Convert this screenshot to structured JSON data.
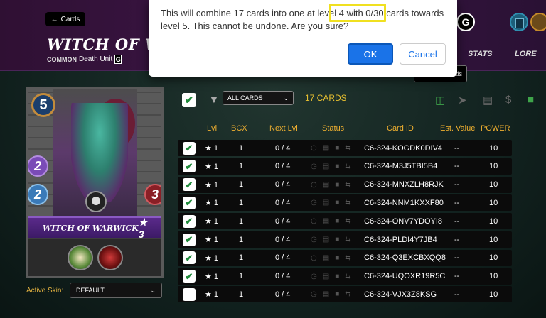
{
  "header": {
    "back_label": "Cards",
    "card_title": "WITCH OF WARW",
    "rarity": "COMMON",
    "subtitle": "Death Unit",
    "edition_logo": "G",
    "tabs": [
      "STATS",
      "LORE"
    ],
    "tooltip_stub": "ds",
    "icons": [
      "gladius-logo-icon",
      "cards-icon",
      "chest-icon"
    ]
  },
  "card": {
    "mana": "5",
    "magic": "2",
    "speed": "2",
    "health": "3",
    "name": "WITCH OF WARWICK",
    "level": "★ 3",
    "abilities": [
      "affliction-icon",
      "life-leech-icon"
    ]
  },
  "skin": {
    "label": "Active Skin:",
    "value": "DEFAULT"
  },
  "toolbar": {
    "filter_value": "ALL CARDS",
    "count": "17 CARDS",
    "icons": [
      "combine-icon",
      "send-icon",
      "market-icon",
      "sell-icon",
      "lock-icon"
    ]
  },
  "table": {
    "columns": [
      "Lvl",
      "BCX",
      "Next Lvl",
      "Status",
      "Card ID",
      "Est. Value",
      "POWER"
    ],
    "rows": [
      {
        "checked": true,
        "lvl": "★ 1",
        "bcx": "1",
        "next": "0 / 4",
        "id": "C6-324-KOGDK0DIV4",
        "est": "--",
        "power": "10"
      },
      {
        "checked": true,
        "lvl": "★ 1",
        "bcx": "1",
        "next": "0 / 4",
        "id": "C6-324-M3J5TBI5B4",
        "est": "--",
        "power": "10"
      },
      {
        "checked": true,
        "lvl": "★ 1",
        "bcx": "1",
        "next": "0 / 4",
        "id": "C6-324-MNXZLH8RJK",
        "est": "--",
        "power": "10"
      },
      {
        "checked": true,
        "lvl": "★ 1",
        "bcx": "1",
        "next": "0 / 4",
        "id": "C6-324-NNM1KXXF80",
        "est": "--",
        "power": "10"
      },
      {
        "checked": true,
        "lvl": "★ 1",
        "bcx": "1",
        "next": "0 / 4",
        "id": "C6-324-ONV7YDOYI8",
        "est": "--",
        "power": "10"
      },
      {
        "checked": true,
        "lvl": "★ 1",
        "bcx": "1",
        "next": "0 / 4",
        "id": "C6-324-PLDI4Y7JB4",
        "est": "--",
        "power": "10"
      },
      {
        "checked": true,
        "lvl": "★ 1",
        "bcx": "1",
        "next": "0 / 4",
        "id": "C6-324-Q3EXCBXQQ8",
        "est": "--",
        "power": "10"
      },
      {
        "checked": true,
        "lvl": "★ 1",
        "bcx": "1",
        "next": "0 / 4",
        "id": "C6-324-UQOXR19R5C",
        "est": "--",
        "power": "10"
      },
      {
        "checked": false,
        "lvl": "★ 1",
        "bcx": "1",
        "next": "0 / 4",
        "id": "C6-324-VJX3Z8KSG",
        "est": "--",
        "power": "10"
      }
    ]
  },
  "dialog": {
    "message": "This will combine 17 cards into one at level 4 with 0/30 cards towards level 5. This cannot be undone. Are you sure?",
    "ok_label": "OK",
    "cancel_label": "Cancel"
  },
  "colors": {
    "accent_gold": "#f0b030",
    "check_green": "#1f8a3a",
    "dialog_primary": "#1a73e8",
    "highlight_yellow": "#f0e020"
  }
}
